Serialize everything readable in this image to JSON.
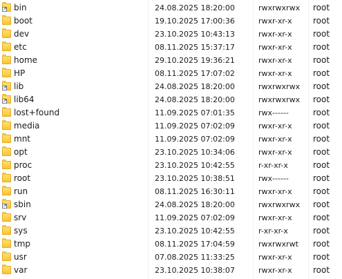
{
  "rows": [
    {
      "name": "bin",
      "modified": "24.08.2025 18:20:00",
      "permissions": "rwxrwxrwx",
      "owner": "root",
      "icon": "folder-link-icon"
    },
    {
      "name": "boot",
      "modified": "19.10.2025 17:00:36",
      "permissions": "rwxr-xr-x",
      "owner": "root",
      "icon": "folder-icon"
    },
    {
      "name": "dev",
      "modified": "23.10.2025 10:43:13",
      "permissions": "rwxr-xr-x",
      "owner": "root",
      "icon": "folder-icon"
    },
    {
      "name": "etc",
      "modified": "08.11.2025 15:37:17",
      "permissions": "rwxr-xr-x",
      "owner": "root",
      "icon": "folder-icon"
    },
    {
      "name": "home",
      "modified": "29.10.2025 19:36:21",
      "permissions": "rwxr-xr-x",
      "owner": "root",
      "icon": "folder-icon"
    },
    {
      "name": "HP",
      "modified": "08.11.2025 17:07:02",
      "permissions": "rwxr-xr-x",
      "owner": "root",
      "icon": "folder-icon"
    },
    {
      "name": "lib",
      "modified": "24.08.2025 18:20:00",
      "permissions": "rwxrwxrwx",
      "owner": "root",
      "icon": "folder-link-icon"
    },
    {
      "name": "lib64",
      "modified": "24.08.2025 18:20:00",
      "permissions": "rwxrwxrwx",
      "owner": "root",
      "icon": "folder-link-icon"
    },
    {
      "name": "lost+found",
      "modified": "11.09.2025 07:01:35",
      "permissions": "rwx------",
      "owner": "root",
      "icon": "folder-icon"
    },
    {
      "name": "media",
      "modified": "11.09.2025 07:02:09",
      "permissions": "rwxr-xr-x",
      "owner": "root",
      "icon": "folder-icon"
    },
    {
      "name": "mnt",
      "modified": "11.09.2025 07:02:09",
      "permissions": "rwxr-xr-x",
      "owner": "root",
      "icon": "folder-icon"
    },
    {
      "name": "opt",
      "modified": "23.10.2025 10:34:06",
      "permissions": "rwxr-xr-x",
      "owner": "root",
      "icon": "folder-icon"
    },
    {
      "name": "proc",
      "modified": "23.10.2025 10:42:55",
      "permissions": "r-xr-xr-x",
      "owner": "root",
      "icon": "folder-icon"
    },
    {
      "name": "root",
      "modified": "23.10.2025 10:38:51",
      "permissions": "rwx------",
      "owner": "root",
      "icon": "folder-icon"
    },
    {
      "name": "run",
      "modified": "08.11.2025 16:30:11",
      "permissions": "rwxr-xr-x",
      "owner": "root",
      "icon": "folder-icon"
    },
    {
      "name": "sbin",
      "modified": "24.08.2025 18:20:00",
      "permissions": "rwxrwxrwx",
      "owner": "root",
      "icon": "folder-link-icon"
    },
    {
      "name": "srv",
      "modified": "11.09.2025 07:02:09",
      "permissions": "rwxr-xr-x",
      "owner": "root",
      "icon": "folder-icon"
    },
    {
      "name": "sys",
      "modified": "23.10.2025 10:42:55",
      "permissions": "r-xr-xr-x",
      "owner": "root",
      "icon": "folder-icon"
    },
    {
      "name": "tmp",
      "modified": "08.11.2025 17:04:59",
      "permissions": "rwxrwxrwt",
      "owner": "root",
      "icon": "folder-icon"
    },
    {
      "name": "usr",
      "modified": "07.08.2025 11:33:25",
      "permissions": "rwxr-xr-x",
      "owner": "root",
      "icon": "folder-icon"
    },
    {
      "name": "var",
      "modified": "23.10.2025 10:38:07",
      "permissions": "rwxr-xr-x",
      "owner": "root",
      "icon": "folder-icon"
    }
  ]
}
